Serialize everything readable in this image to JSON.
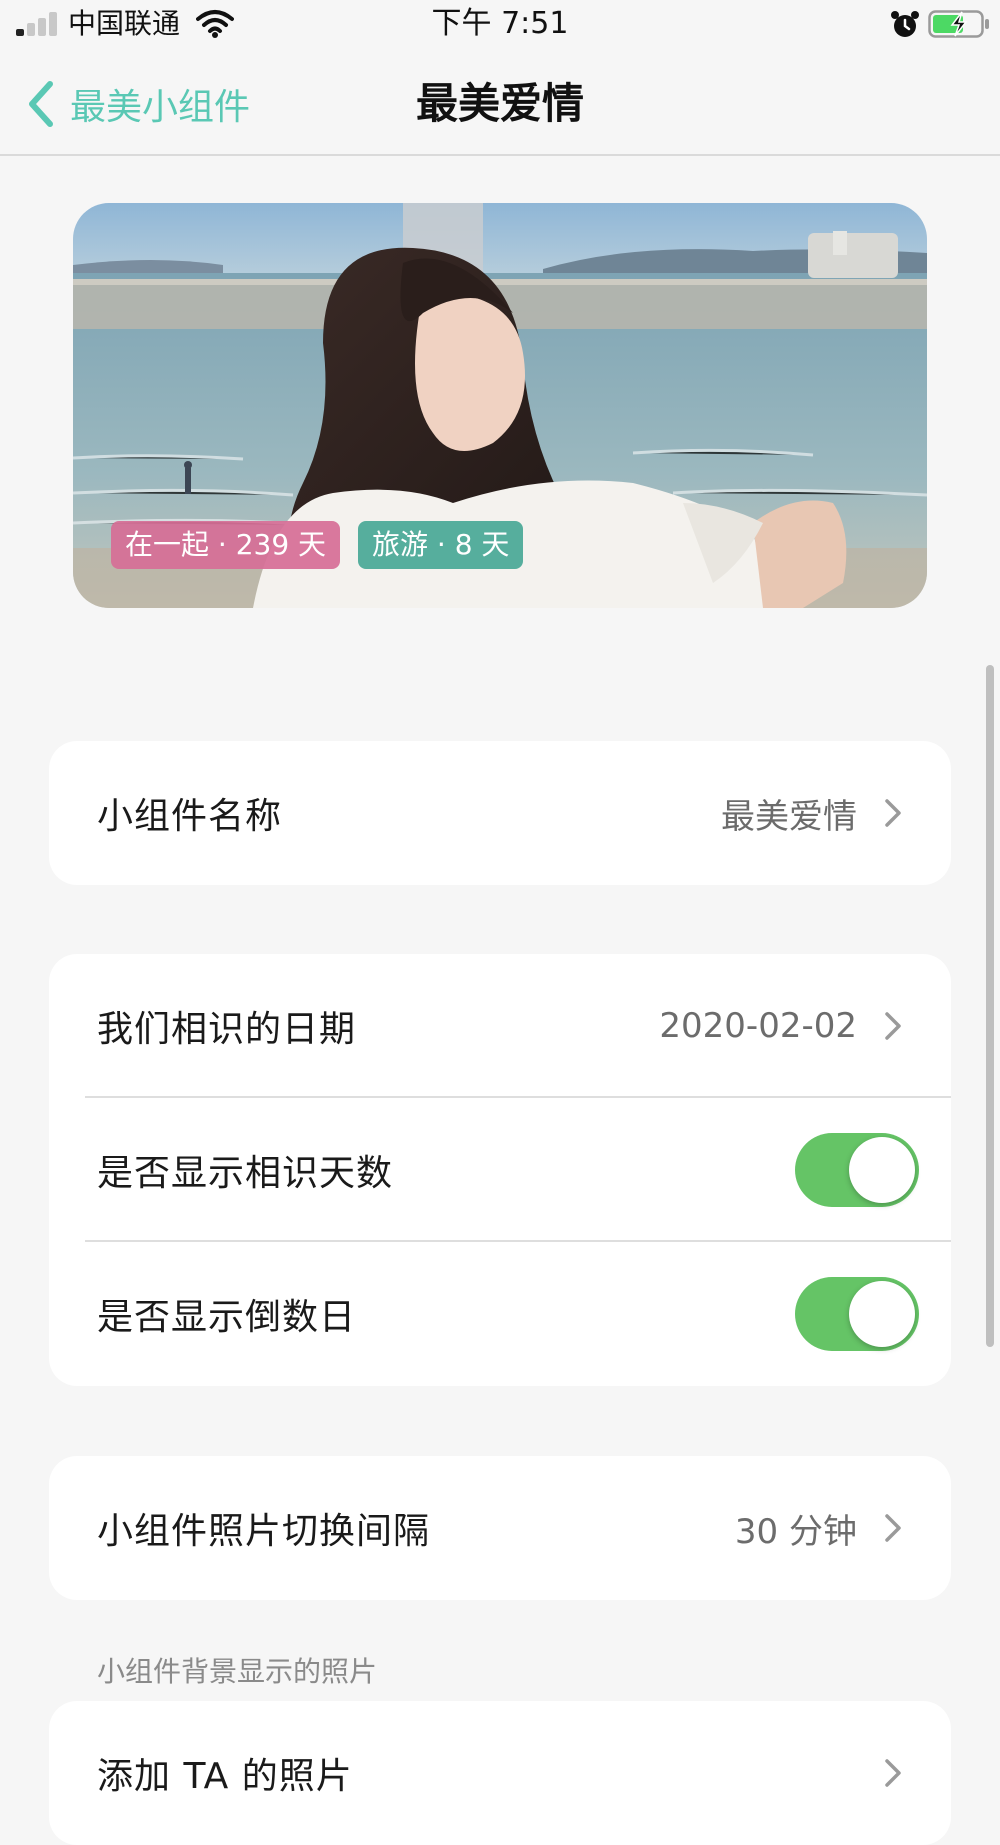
{
  "status_bar": {
    "carrier": "中国联通",
    "time": "下午 7:51"
  },
  "nav": {
    "back_label": "最美小组件",
    "title": "最美爱情"
  },
  "widget_preview": {
    "tag_together": "在一起 · 239 天",
    "tag_travel": "旅游 · 8 天"
  },
  "settings": {
    "name_row": {
      "label": "小组件名称",
      "value": "最美爱情"
    },
    "date_row": {
      "label": "我们相识的日期",
      "value": "2020-02-02"
    },
    "show_days_row": {
      "label": "是否显示相识天数",
      "enabled": true
    },
    "show_countdown_row": {
      "label": "是否显示倒数日",
      "enabled": true
    },
    "interval_row": {
      "label": "小组件照片切换间隔",
      "value": "30 分钟"
    },
    "photos_section_header": "小组件背景显示的照片",
    "add_photo_row": {
      "label": "添加 TA 的照片"
    }
  },
  "colors": {
    "accent": "#5ac8b4",
    "toggle_on": "#65c466",
    "background": "#f6f6f6"
  }
}
